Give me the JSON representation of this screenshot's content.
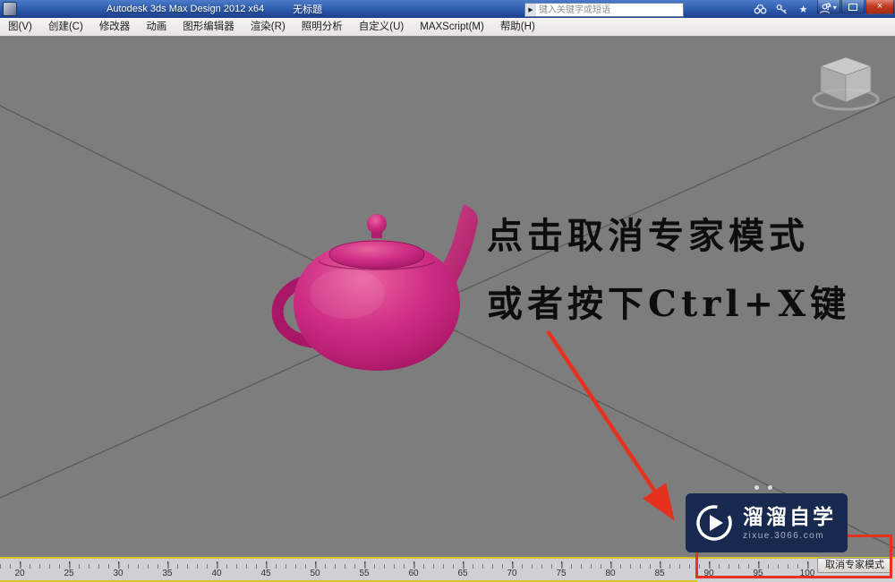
{
  "titlebar": {
    "app_title": "Autodesk 3ds Max Design 2012 x64",
    "document_title": "无标题",
    "search": {
      "placeholder": "键入关键字或短语",
      "go_icon": "▶"
    },
    "icons": {
      "star": "★",
      "dropdown": "▾"
    },
    "help_label": "?",
    "window_buttons": {
      "minimize": "–",
      "close": "×"
    }
  },
  "menu": {
    "items": [
      "图(V)",
      "创建(C)",
      "修改器",
      "动画",
      "图形编辑器",
      "渲染(R)",
      "照明分析",
      "自定义(U)",
      "MAXScript(M)",
      "帮助(H)"
    ]
  },
  "viewport": {
    "annotation_line1": "点击取消专家模式",
    "annotation_line2": "或者按下Ctrl+X键"
  },
  "watermark": {
    "brand": "溜溜自学",
    "site": "zixue.3066.com"
  },
  "bottom": {
    "expert_mode_button": "取消专家模式",
    "timeline_labels": [
      "20",
      "25",
      "30",
      "35",
      "40",
      "45",
      "50",
      "55",
      "60",
      "65",
      "70",
      "75",
      "80",
      "85",
      "90",
      "95",
      "100"
    ]
  },
  "colors": {
    "title_blue": "#2d59a8",
    "viewport_gray": "#7d7d7d",
    "teapot_magenta": "#c9267f",
    "annotation_red": "#e5321e",
    "highlight_yellow": "#d9c42a",
    "watermark_navy": "#17294e"
  }
}
